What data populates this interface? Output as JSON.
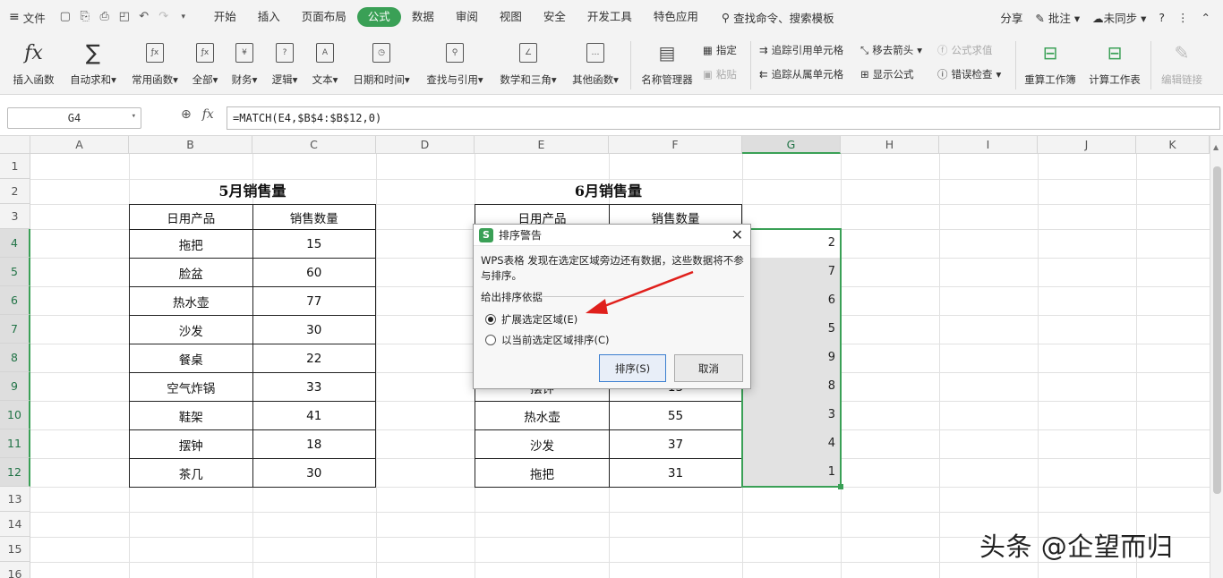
{
  "menu": {
    "file_label": "文件",
    "tabs": [
      "开始",
      "插入",
      "页面布局",
      "公式",
      "数据",
      "审阅",
      "视图",
      "安全",
      "开发工具",
      "特色应用"
    ],
    "active_tab": "公式",
    "search_label": "查找命令、搜索模板",
    "share_label": "分享",
    "annotate_label": "批注",
    "sync_label": "未同步",
    "help_label": "?"
  },
  "ribbon": {
    "insert_function": "插入函数",
    "autosum": "自动求和",
    "common_funcs": "常用函数",
    "all": "全部",
    "finance": "财务",
    "logic": "逻辑",
    "text": "文本",
    "datetime": "日期和时间",
    "lookup": "查找与引用",
    "math": "数学和三角",
    "other": "其他函数",
    "name_manager": "名称管理器",
    "specify": "指定",
    "paste": "粘贴",
    "trace_precedents": "追踪引用单元格",
    "trace_dependents": "追踪从属单元格",
    "remove_arrows": "移去箭头",
    "show_formulas": "显示公式",
    "eval_formula": "公式求值",
    "error_check": "错误检查",
    "recalc_workbook": "重算工作簿",
    "calc_sheet": "计算工作表",
    "edit_links": "编辑链接"
  },
  "formula_bar": {
    "name_box": "G4",
    "formula": "=MATCH(E4,$B$4:$B$12,0)"
  },
  "columns": [
    "A",
    "B",
    "C",
    "D",
    "E",
    "F",
    "G",
    "H",
    "I",
    "J",
    "K"
  ],
  "rows": [
    "1",
    "2",
    "3",
    "4",
    "5",
    "6",
    "7",
    "8",
    "9",
    "10",
    "11",
    "12",
    "13",
    "14",
    "15",
    "16"
  ],
  "table1": {
    "title": "5月销售量",
    "headers": [
      "日用产品",
      "销售数量"
    ],
    "rows": [
      [
        "拖把",
        "15"
      ],
      [
        "脸盆",
        "60"
      ],
      [
        "热水壶",
        "77"
      ],
      [
        "沙发",
        "30"
      ],
      [
        "餐桌",
        "22"
      ],
      [
        "空气炸锅",
        "33"
      ],
      [
        "鞋架",
        "41"
      ],
      [
        "摆钟",
        "18"
      ],
      [
        "茶几",
        "30"
      ]
    ]
  },
  "table2": {
    "title": "6月销售量",
    "headers": [
      "日用产品",
      "销售数量"
    ],
    "partial_row9": [
      "摆钟",
      "13"
    ],
    "rows": [
      [
        "热水壶",
        "55"
      ],
      [
        "沙发",
        "37"
      ],
      [
        "拖把",
        "31"
      ]
    ]
  },
  "column_g_values": [
    "2",
    "7",
    "6",
    "5",
    "9",
    "8",
    "3",
    "4",
    "1"
  ],
  "dialog": {
    "title": "排序警告",
    "message": "WPS表格 发现在选定区域旁边还有数据，这些数据将不参与排序。",
    "group_label": "给出排序依据",
    "option1": "扩展选定区域(E)",
    "option2": "以当前选定区域排序(C)",
    "sort_button": "排序(S)",
    "cancel_button": "取消"
  },
  "watermark": "头条 @企望而归",
  "colors": {
    "accent": "#3aa056",
    "arrow": "#e0201c"
  }
}
